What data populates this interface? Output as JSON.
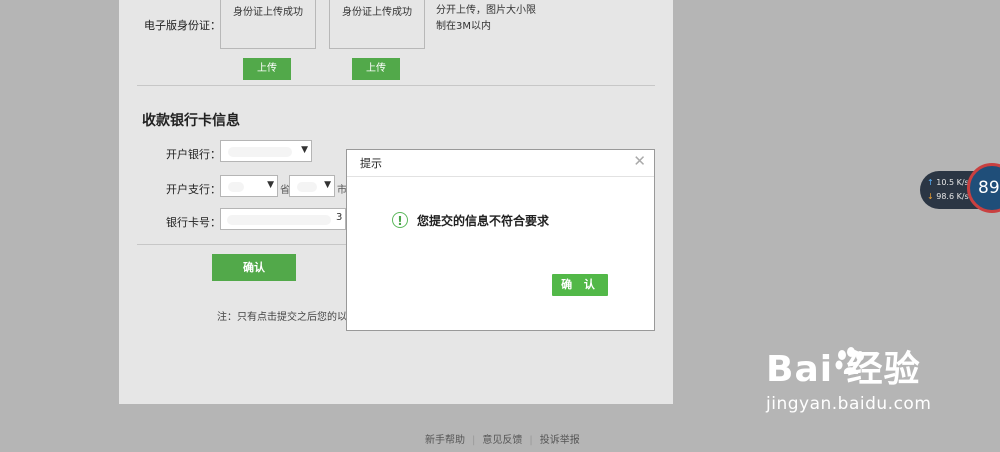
{
  "id_section": {
    "label": "电子版身份证：",
    "upload_box_1": "身份证上传成功",
    "upload_box_2": "身份证上传成功",
    "upload_button_1": "上传",
    "upload_button_2": "上传",
    "hint_line_1": "分开上传，图片大小限",
    "hint_line_2": "制在3M以内"
  },
  "bank_section": {
    "title": "收款银行卡信息",
    "bank_label": "开户银行：",
    "branch_label": "开户支行：",
    "province_suffix": "省",
    "city_suffix": "市",
    "card_label": "银行卡号：",
    "card_tail": "3",
    "confirm_button": "确认",
    "note": "注：只有点击提交之后您的以上"
  },
  "dialog": {
    "title": "提示",
    "close_icon": "close-icon",
    "message": "您提交的信息不符合要求",
    "ok_button": "确 认",
    "icon_glyph": "!"
  },
  "footer": {
    "links": [
      "新手帮助",
      "意见反馈",
      "投诉举报"
    ]
  },
  "speed_widget": {
    "upload": "10.5",
    "upload_unit": "K/s",
    "download": "98.6",
    "download_unit": "K/s",
    "gauge": "89"
  },
  "watermark": {
    "logo": "Bai  经验",
    "url": "jingyan.baidu.com"
  },
  "colors": {
    "accent_green": "#52a94a",
    "overlay": "#b5b5b5"
  }
}
